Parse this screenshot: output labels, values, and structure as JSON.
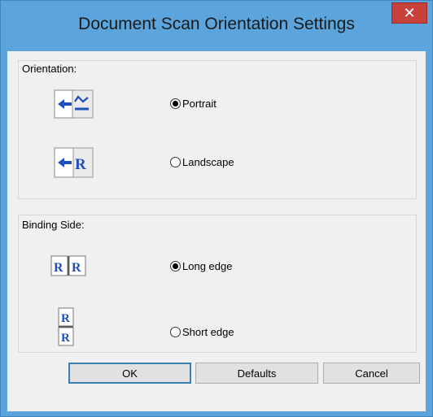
{
  "window": {
    "title": "Document Scan Orientation Settings",
    "close_glyph": "✕"
  },
  "orientation": {
    "label": "Orientation:",
    "options": [
      {
        "label": "Portrait",
        "checked": true,
        "icon": "portrait-orientation-icon"
      },
      {
        "label": "Landscape",
        "checked": false,
        "icon": "landscape-orientation-icon"
      }
    ]
  },
  "binding": {
    "label": "Binding Side:",
    "options": [
      {
        "label": "Long edge",
        "checked": true,
        "icon": "long-edge-binding-icon"
      },
      {
        "label": "Short edge",
        "checked": false,
        "icon": "short-edge-binding-icon"
      }
    ]
  },
  "buttons": {
    "ok": "OK",
    "defaults": "Defaults",
    "cancel": "Cancel"
  },
  "colors": {
    "title_bar": "#5ba5dc",
    "close_button": "#c7403a",
    "dialog_bg": "#f0f0f0",
    "icon_blue": "#1f4fbf"
  }
}
